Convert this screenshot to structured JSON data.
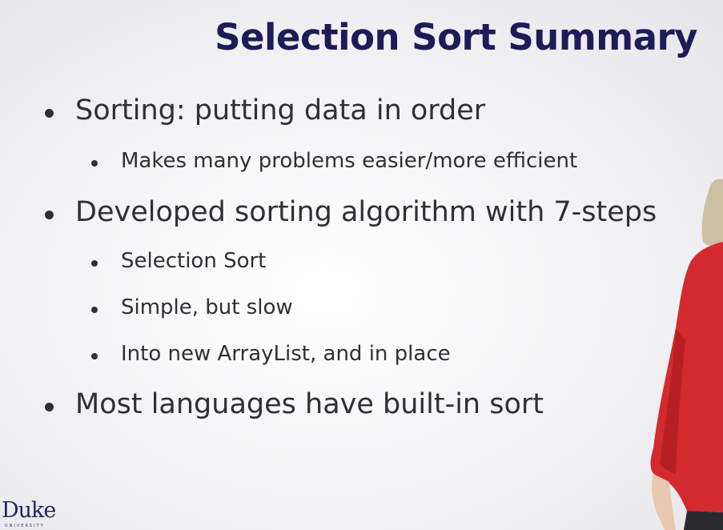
{
  "slide": {
    "title": "Selection Sort Summary",
    "bullets": [
      {
        "text": "Sorting: putting data in order"
      },
      {
        "text": "Makes many problems easier/more efficient"
      },
      {
        "text": "Developed sorting algorithm with 7-steps"
      },
      {
        "text": "Selection Sort"
      },
      {
        "text": "Simple, but slow"
      },
      {
        "text": "Into new ArrayList, and in place"
      },
      {
        "text": "Most languages have built-in sort"
      }
    ]
  },
  "branding": {
    "logo_text": "Duke",
    "logo_subtext": "UNIVERSITY"
  },
  "colors": {
    "title": "#1d1b58",
    "body_text": "#2f2f35",
    "presenter_shirt": "#d22a2e",
    "logo": "#1c2a5a"
  }
}
